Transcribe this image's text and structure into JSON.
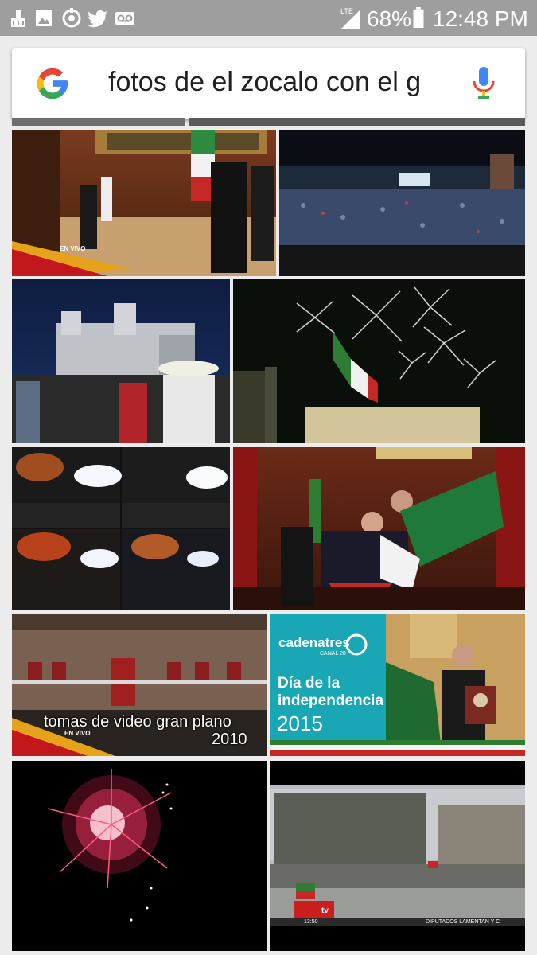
{
  "status_bar": {
    "network_label": "LTE",
    "battery_percent": "68%",
    "time": "12:48 PM",
    "notification_icons": [
      "cleaner-icon",
      "gallery-icon",
      "sync-icon",
      "twitter-icon",
      "voicemail-icon"
    ]
  },
  "search": {
    "query": "fotos de el zocalo con el g",
    "logo": "google-logo",
    "voice_icon": "mic-icon"
  },
  "results": [
    {
      "live_label": "EN VIVO"
    },
    {},
    {},
    {},
    {},
    {},
    {
      "caption_line1": "tomas de video gran plano",
      "caption_line2": "2010",
      "live_label": "EN VIVO"
    },
    {
      "brand": "cadenatres",
      "brand_sub": "CANAL 28",
      "title_line1": "Día de la",
      "title_line2": "independencia",
      "year": "2015"
    },
    {},
    {
      "channel": "tv",
      "clock": "13:50",
      "ticker": "DIPUTADOS LAMENTAN Y C"
    }
  ],
  "colors": {
    "status_bar": "#9e9e9e",
    "background": "#ececec",
    "google_blue": "#4285F4",
    "google_red": "#EA4335",
    "google_yellow": "#FBBC05",
    "google_green": "#34A853",
    "cadenatres_teal": "#1aa7b5"
  }
}
